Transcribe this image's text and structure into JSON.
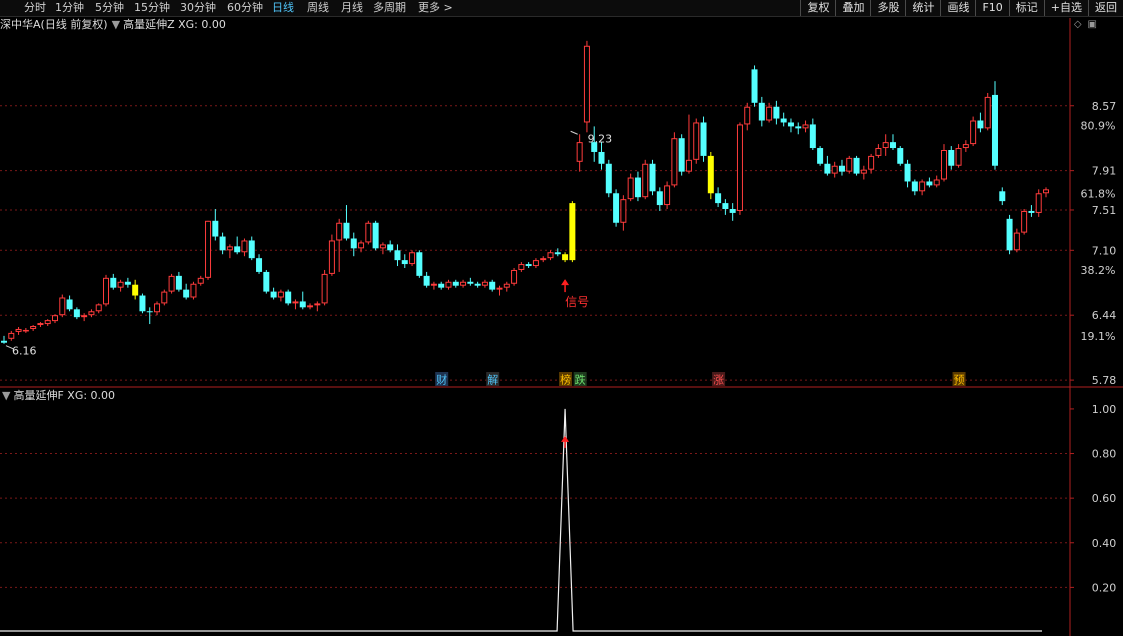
{
  "toolbar": {
    "periods": [
      "分时",
      "1分钟",
      "5分钟",
      "15分钟",
      "30分钟",
      "60分钟",
      "日线",
      "周线",
      "月线",
      "多周期",
      "更多 >"
    ],
    "active_period": "日线",
    "buttons": [
      "复权",
      "叠加",
      "多股",
      "统计",
      "画线",
      "F10",
      "标记",
      "+自选",
      "返回"
    ]
  },
  "main_panel": {
    "title": "深中华A(日线 前复权)",
    "indicator": "高量延伸Z",
    "xg_text": "XG: 0.00",
    "price_axis": [
      "8.57",
      "7.91",
      "7.51",
      "7.10",
      "6.44",
      "5.78"
    ],
    "pct_axis": [
      "80.9%",
      "61.8%",
      "38.2%",
      "19.1%"
    ],
    "high_label": "9.23",
    "low_label": "6.16",
    "signal_label": "信号",
    "markers": [
      {
        "text": "财",
        "color": "#4fc3f7",
        "bg": "#1e3350"
      },
      {
        "text": "解",
        "color": "#4fc3f7",
        "bg": "#2a2a2a"
      },
      {
        "text": "榜",
        "color": "#ffc000",
        "bg": "#5a3a00"
      },
      {
        "text": "跌",
        "color": "#6ee06e",
        "bg": "#1e3a1e"
      },
      {
        "text": "涨",
        "color": "#ff5050",
        "bg": "#4a1a1a"
      },
      {
        "text": "预",
        "color": "#ffc000",
        "bg": "#5a3a00"
      }
    ],
    "colors": {
      "up": "#ff3c3c",
      "down": "#54ffff",
      "signal": "#ffff00",
      "grid": "#7a1818"
    }
  },
  "sub_panel": {
    "indicator": "高量延伸F",
    "xg_text": "XG: 0.00",
    "axis": [
      "1.00",
      "0.80",
      "0.60",
      "0.40",
      "0.20"
    ]
  },
  "chart_data": {
    "type": "candlestick",
    "candles": [
      [
        6.18,
        6.23,
        6.15,
        6.16
      ],
      [
        6.2,
        6.28,
        6.18,
        6.26
      ],
      [
        6.27,
        6.32,
        6.24,
        6.3
      ],
      [
        6.28,
        6.31,
        6.26,
        6.29
      ],
      [
        6.3,
        6.34,
        6.28,
        6.33
      ],
      [
        6.34,
        6.37,
        6.32,
        6.36
      ],
      [
        6.35,
        6.4,
        6.33,
        6.39
      ],
      [
        6.38,
        6.45,
        6.36,
        6.44
      ],
      [
        6.44,
        6.65,
        6.42,
        6.62
      ],
      [
        6.6,
        6.64,
        6.48,
        6.5
      ],
      [
        6.5,
        6.52,
        6.4,
        6.42
      ],
      [
        6.42,
        6.46,
        6.38,
        6.44
      ],
      [
        6.44,
        6.5,
        6.42,
        6.48
      ],
      [
        6.48,
        6.56,
        6.46,
        6.55
      ],
      [
        6.55,
        6.85,
        6.53,
        6.82
      ],
      [
        6.82,
        6.86,
        6.7,
        6.72
      ],
      [
        6.72,
        6.8,
        6.68,
        6.78
      ],
      [
        6.78,
        6.82,
        6.72,
        6.75
      ],
      [
        6.75,
        6.8,
        6.6,
        6.64
      ],
      [
        6.64,
        6.66,
        6.46,
        6.48
      ],
      [
        6.48,
        6.52,
        6.35,
        6.47
      ],
      [
        6.47,
        6.58,
        6.44,
        6.56
      ],
      [
        6.56,
        6.7,
        6.54,
        6.68
      ],
      [
        6.68,
        6.86,
        6.66,
        6.84
      ],
      [
        6.84,
        6.88,
        6.68,
        6.7
      ],
      [
        6.7,
        6.76,
        6.6,
        6.62
      ],
      [
        6.62,
        6.78,
        6.6,
        6.76
      ],
      [
        6.76,
        6.84,
        6.74,
        6.82
      ],
      [
        6.82,
        7.4,
        6.8,
        7.4
      ],
      [
        7.4,
        7.52,
        7.2,
        7.24
      ],
      [
        7.24,
        7.28,
        7.06,
        7.1
      ],
      [
        7.1,
        7.16,
        7.02,
        7.14
      ],
      [
        7.14,
        7.24,
        7.06,
        7.08
      ],
      [
        7.08,
        7.22,
        7.04,
        7.2
      ],
      [
        7.2,
        7.24,
        7.0,
        7.02
      ],
      [
        7.02,
        7.06,
        6.86,
        6.88
      ],
      [
        6.88,
        6.9,
        6.66,
        6.68
      ],
      [
        6.68,
        6.72,
        6.6,
        6.62
      ],
      [
        6.62,
        6.7,
        6.58,
        6.68
      ],
      [
        6.68,
        6.7,
        6.54,
        6.56
      ],
      [
        6.56,
        6.6,
        6.5,
        6.58
      ],
      [
        6.58,
        6.68,
        6.5,
        6.52
      ],
      [
        6.52,
        6.56,
        6.5,
        6.54
      ],
      [
        6.54,
        6.58,
        6.48,
        6.56
      ],
      [
        6.56,
        6.9,
        6.54,
        6.86
      ],
      [
        6.86,
        7.26,
        6.84,
        7.2
      ],
      [
        7.2,
        7.42,
        6.88,
        7.38
      ],
      [
        7.38,
        7.56,
        7.2,
        7.22
      ],
      [
        7.22,
        7.28,
        7.04,
        7.12
      ],
      [
        7.12,
        7.2,
        7.08,
        7.18
      ],
      [
        7.18,
        7.4,
        7.16,
        7.38
      ],
      [
        7.38,
        7.4,
        7.1,
        7.12
      ],
      [
        7.12,
        7.18,
        7.06,
        7.16
      ],
      [
        7.16,
        7.2,
        7.08,
        7.1
      ],
      [
        7.1,
        7.16,
        6.94,
        7.0
      ],
      [
        7.0,
        7.06,
        6.92,
        6.96
      ],
      [
        6.96,
        7.1,
        6.94,
        7.08
      ],
      [
        7.08,
        7.1,
        6.82,
        6.84
      ],
      [
        6.84,
        6.88,
        6.72,
        6.74
      ],
      [
        6.74,
        6.78,
        6.7,
        6.76
      ],
      [
        6.76,
        6.78,
        6.7,
        6.72
      ],
      [
        6.72,
        6.8,
        6.7,
        6.78
      ],
      [
        6.78,
        6.8,
        6.72,
        6.74
      ],
      [
        6.74,
        6.8,
        6.72,
        6.78
      ],
      [
        6.78,
        6.82,
        6.74,
        6.76
      ],
      [
        6.76,
        6.78,
        6.72,
        6.74
      ],
      [
        6.74,
        6.8,
        6.72,
        6.78
      ],
      [
        6.78,
        6.8,
        6.68,
        6.7
      ],
      [
        6.7,
        6.74,
        6.64,
        6.72
      ],
      [
        6.72,
        6.78,
        6.68,
        6.76
      ],
      [
        6.76,
        6.92,
        6.74,
        6.9
      ],
      [
        6.9,
        6.98,
        6.88,
        6.96
      ],
      [
        6.96,
        6.98,
        6.92,
        6.94
      ],
      [
        6.94,
        7.02,
        6.92,
        7.0
      ],
      [
        7.0,
        7.04,
        6.98,
        7.02
      ],
      [
        7.02,
        7.1,
        7.0,
        7.08
      ],
      [
        7.08,
        7.12,
        7.04,
        7.06
      ],
      [
        7.06,
        7.08,
        6.98,
        7.0
      ],
      [
        7.0,
        7.6,
        6.98,
        7.58
      ],
      [
        8.0,
        8.28,
        7.9,
        8.2
      ],
      [
        8.4,
        9.23,
        8.3,
        9.18
      ],
      [
        8.2,
        8.36,
        8.0,
        8.1
      ],
      [
        8.1,
        8.2,
        7.92,
        7.98
      ],
      [
        7.98,
        8.02,
        7.64,
        7.68
      ],
      [
        7.68,
        7.72,
        7.34,
        7.38
      ],
      [
        7.38,
        7.66,
        7.3,
        7.62
      ],
      [
        7.62,
        7.88,
        7.6,
        7.84
      ],
      [
        7.84,
        7.9,
        7.6,
        7.64
      ],
      [
        7.64,
        8.02,
        7.62,
        7.98
      ],
      [
        7.98,
        8.02,
        7.66,
        7.7
      ],
      [
        7.7,
        7.74,
        7.5,
        7.56
      ],
      [
        7.56,
        7.8,
        7.52,
        7.76
      ],
      [
        7.76,
        8.3,
        7.74,
        8.24
      ],
      [
        8.24,
        8.28,
        7.86,
        7.9
      ],
      [
        7.9,
        8.48,
        7.88,
        8.02
      ],
      [
        8.02,
        8.44,
        7.98,
        8.4
      ],
      [
        8.4,
        8.46,
        8.0,
        8.06
      ],
      [
        8.06,
        8.1,
        7.62,
        7.68
      ],
      [
        7.68,
        7.74,
        7.54,
        7.58
      ],
      [
        7.58,
        7.62,
        7.46,
        7.52
      ],
      [
        7.52,
        7.58,
        7.4,
        7.48
      ],
      [
        7.5,
        8.4,
        7.46,
        8.38
      ],
      [
        8.38,
        8.6,
        8.32,
        8.56
      ],
      [
        8.94,
        8.98,
        8.56,
        8.6
      ],
      [
        8.6,
        8.66,
        8.36,
        8.42
      ],
      [
        8.42,
        8.6,
        8.4,
        8.56
      ],
      [
        8.56,
        8.62,
        8.38,
        8.44
      ],
      [
        8.44,
        8.5,
        8.36,
        8.4
      ],
      [
        8.4,
        8.44,
        8.3,
        8.36
      ],
      [
        8.36,
        8.4,
        8.28,
        8.34
      ],
      [
        8.34,
        8.42,
        8.3,
        8.38
      ],
      [
        8.38,
        8.44,
        8.12,
        8.14
      ],
      [
        8.14,
        8.16,
        7.96,
        7.98
      ],
      [
        7.98,
        8.06,
        7.86,
        7.88
      ],
      [
        7.88,
        8.0,
        7.84,
        7.96
      ],
      [
        7.96,
        8.02,
        7.86,
        7.9
      ],
      [
        7.9,
        8.06,
        7.88,
        8.04
      ],
      [
        8.04,
        8.06,
        7.86,
        7.88
      ],
      [
        7.88,
        7.96,
        7.82,
        7.92
      ],
      [
        7.92,
        8.08,
        7.88,
        8.06
      ],
      [
        8.06,
        8.18,
        8.04,
        8.14
      ],
      [
        8.14,
        8.28,
        8.06,
        8.2
      ],
      [
        8.2,
        8.28,
        8.12,
        8.14
      ],
      [
        8.14,
        8.16,
        7.96,
        7.98
      ],
      [
        7.98,
        8.02,
        7.74,
        7.8
      ],
      [
        7.8,
        7.82,
        7.66,
        7.7
      ],
      [
        7.7,
        7.82,
        7.66,
        7.8
      ],
      [
        7.8,
        7.84,
        7.74,
        7.76
      ],
      [
        7.76,
        7.86,
        7.74,
        7.82
      ],
      [
        7.82,
        8.18,
        7.8,
        8.12
      ],
      [
        8.12,
        8.16,
        7.92,
        7.96
      ],
      [
        7.96,
        8.18,
        7.94,
        8.14
      ],
      [
        8.14,
        8.22,
        8.1,
        8.18
      ],
      [
        8.18,
        8.46,
        8.16,
        8.42
      ],
      [
        8.42,
        8.5,
        8.3,
        8.34
      ],
      [
        8.34,
        8.7,
        8.32,
        8.66
      ],
      [
        8.68,
        8.82,
        7.92,
        7.96
      ],
      [
        7.7,
        7.74,
        7.56,
        7.6
      ],
      [
        7.42,
        7.46,
        7.06,
        7.1
      ],
      [
        7.1,
        7.32,
        7.08,
        7.28
      ],
      [
        7.28,
        7.52,
        7.26,
        7.5
      ],
      [
        7.5,
        7.56,
        7.44,
        7.48
      ],
      [
        7.48,
        7.72,
        7.44,
        7.68
      ],
      [
        7.68,
        7.74,
        7.64,
        7.72
      ]
    ],
    "signal_bars": [
      18,
      77,
      78,
      97
    ],
    "signal_index": 77,
    "marker_indices": [
      60,
      67,
      77,
      79,
      98,
      131
    ],
    "high_index": 79,
    "low_index": 0,
    "sub_series_peak": {
      "index": 77,
      "value": 1.0
    },
    "price_range": [
      5.72,
      9.32
    ],
    "sub_range": [
      0,
      1.04
    ]
  }
}
